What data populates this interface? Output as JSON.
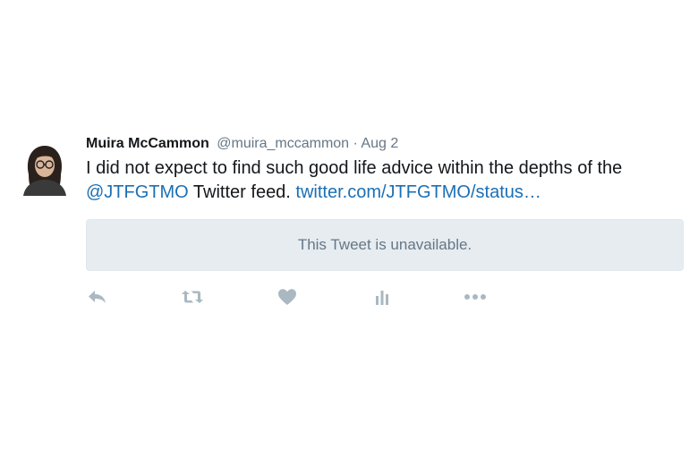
{
  "tweet": {
    "author_name": "Muira McCammon",
    "handle": "@muira_mccammon",
    "separator": "·",
    "date": "Aug 2",
    "text_part1": "I did not expect to find such good life advice within the depths of the ",
    "mention": "@JTFGTMO",
    "text_part2": " Twitter feed. ",
    "link": "twitter.com/JTFGTMO/status…",
    "quoted_notice": "This Tweet is unavailable."
  },
  "actions": [
    {
      "icon": "reply-icon"
    },
    {
      "icon": "retweet-icon"
    },
    {
      "icon": "heart-icon"
    },
    {
      "icon": "analytics-icon"
    },
    {
      "icon": "more-icon"
    }
  ],
  "colors": {
    "text": "#14171a",
    "secondary": "#657786",
    "link": "#1b6fb5",
    "card_bg": "#e6ecf0",
    "icon": "#aab8c2"
  }
}
